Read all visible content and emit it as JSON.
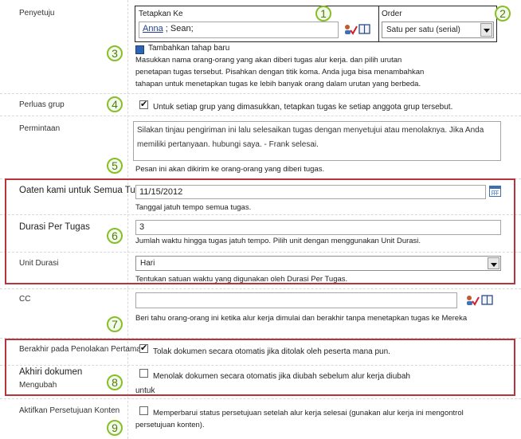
{
  "approvers": {
    "label": "Penyetuju",
    "assign_to_header": "Tetapkan Ke",
    "assign_to_value_1": "Anna",
    "assign_to_value_2": "; Sean;",
    "order_header": "Order",
    "order_value": "Satu per satu (serial)",
    "add_stage_link": "Tambahkan tahap baru",
    "help_text": "Masukkan nama orang-orang yang akan diberi tugas alur kerja. dan pilih urutan penetapan tugas tersebut. Pisahkan dengan titik koma. Anda juga bisa menambahkan tahapan untuk menetapkan tugas ke lebih banyak orang dalam urutan yang berbeda."
  },
  "expand_groups": {
    "label": "Perluas grup",
    "checkbox_label": "Untuk setiap grup yang dimasukkan, tetapkan tugas ke setiap anggota grup tersebut.",
    "checked": true
  },
  "request": {
    "label": "Permintaan",
    "value": "Silakan tinjau pengiriman ini lalu selesaikan tugas dengan menyetujui atau menolaknya. Jika Anda memiliki pertanyaan. hubungi saya. - Frank selesai.",
    "help_text": "Pesan ini akan dikirim ke orang-orang yang diberi tugas."
  },
  "due_date": {
    "label": "Oaten kami untuk Semua Tugas",
    "value": "11/15/2012",
    "help_text": "Tanggal jatuh tempo semua tugas."
  },
  "duration": {
    "label": "Durasi Per Tugas",
    "value": "3",
    "help_text": "Jumlah waktu hingga tugas jatuh tempo. Pilih unit dengan menggunakan Unit Durasi."
  },
  "duration_units": {
    "label": "Unit Durasi",
    "value": "Hari",
    "help_text": "Tentukan satuan waktu yang digunakan oleh Durasi Per Tugas."
  },
  "cc": {
    "label": "CC",
    "value": "",
    "help_text": "Beri tahu orang-orang ini ketika alur kerja dimulai dan berakhir tanpa menetapkan tugas ke Mereka"
  },
  "end_on_rejection": {
    "label": "Berakhir pada Penolakan Pertama",
    "checkbox_label": "Tolak dokumen secara otomatis jika ditolak oleh peserta mana pun.",
    "checked": true
  },
  "end_on_change": {
    "label_line1": "Akhiri dokumen",
    "label_line2": "Mengubah",
    "checkbox_label_line1": "Menolak dokumen secara otomatis jika diubah sebelum alur kerja diubah",
    "checkbox_label_line2": "untuk",
    "checked": false
  },
  "content_approval": {
    "label": "Aktifkan Persetujuan Konten",
    "checkbox_label": "Memperbarui status persetujuan setelah alur kerja selesai (gunakan alur kerja ini mengontrol persetujuan konten).",
    "checked": false
  },
  "callouts": [
    "1",
    "2",
    "3",
    "4",
    "5",
    "6",
    "7",
    "8",
    "9"
  ],
  "icons": {
    "check_names": "check-names-icon",
    "address_book": "address-book-icon",
    "calendar": "calendar-icon",
    "add_stage": "add-stage-icon"
  },
  "colors": {
    "callout_green": "#86bf2a",
    "highlight_red": "#b7343a",
    "link_blue": "#1e5ba8"
  }
}
